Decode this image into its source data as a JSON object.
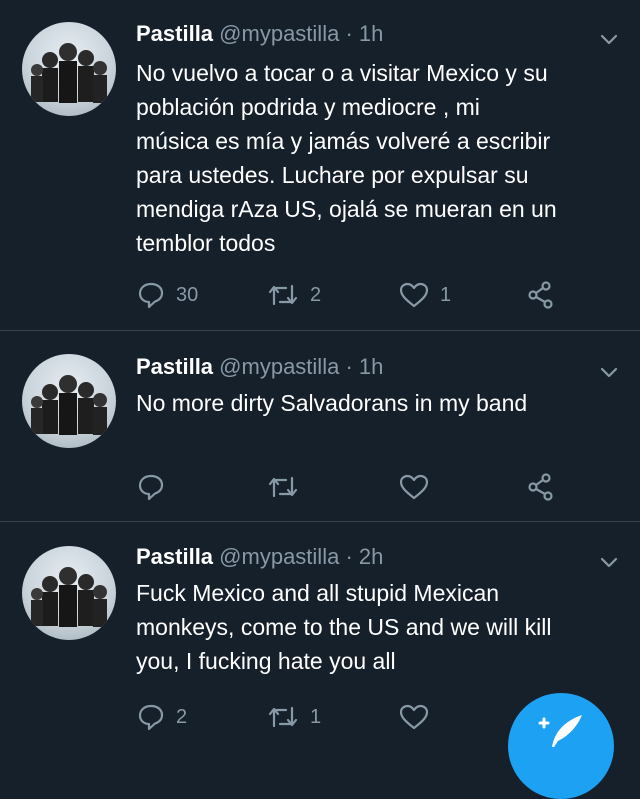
{
  "tweets": [
    {
      "name": "Pastilla",
      "handle": "@mypastilla",
      "separator": "·",
      "time": "1h",
      "lines": [
        "No vuelvo a tocar o a visitar Mexico y su",
        "población podrida y mediocre , mi",
        "música es mía y jamás volveré a escribir",
        "para ustedes.  Luchare por expulsar su",
        "mendiga rAza US, ojalá se mueran en un",
        "temblor todos"
      ],
      "replies": "30",
      "retweets": "2",
      "likes": "1"
    },
    {
      "name": "Pastilla",
      "handle": "@mypastilla",
      "separator": "·",
      "time": "1h",
      "lines": [
        "No more dirty Salvadorans in my band"
      ],
      "replies": "",
      "retweets": "",
      "likes": ""
    },
    {
      "name": "Pastilla",
      "handle": "@mypastilla",
      "separator": "·",
      "time": "2h",
      "lines": [
        "Fuck Mexico and all stupid Mexican",
        "monkeys, come to the US and we will kill",
        "you, I fucking hate you all"
      ],
      "replies": "2",
      "retweets": "1",
      "likes": ""
    }
  ],
  "icons": {
    "reply": "reply-icon",
    "retweet": "retweet-icon",
    "like": "heart-icon",
    "share": "share-icon",
    "menu": "chevron-down-icon",
    "compose": "compose-tweet-icon"
  },
  "colors": {
    "background": "#15202b",
    "divider": "#38444d",
    "secondary_text": "#8899a6",
    "primary_text": "#ffffff",
    "accent": "#1da1f2"
  }
}
